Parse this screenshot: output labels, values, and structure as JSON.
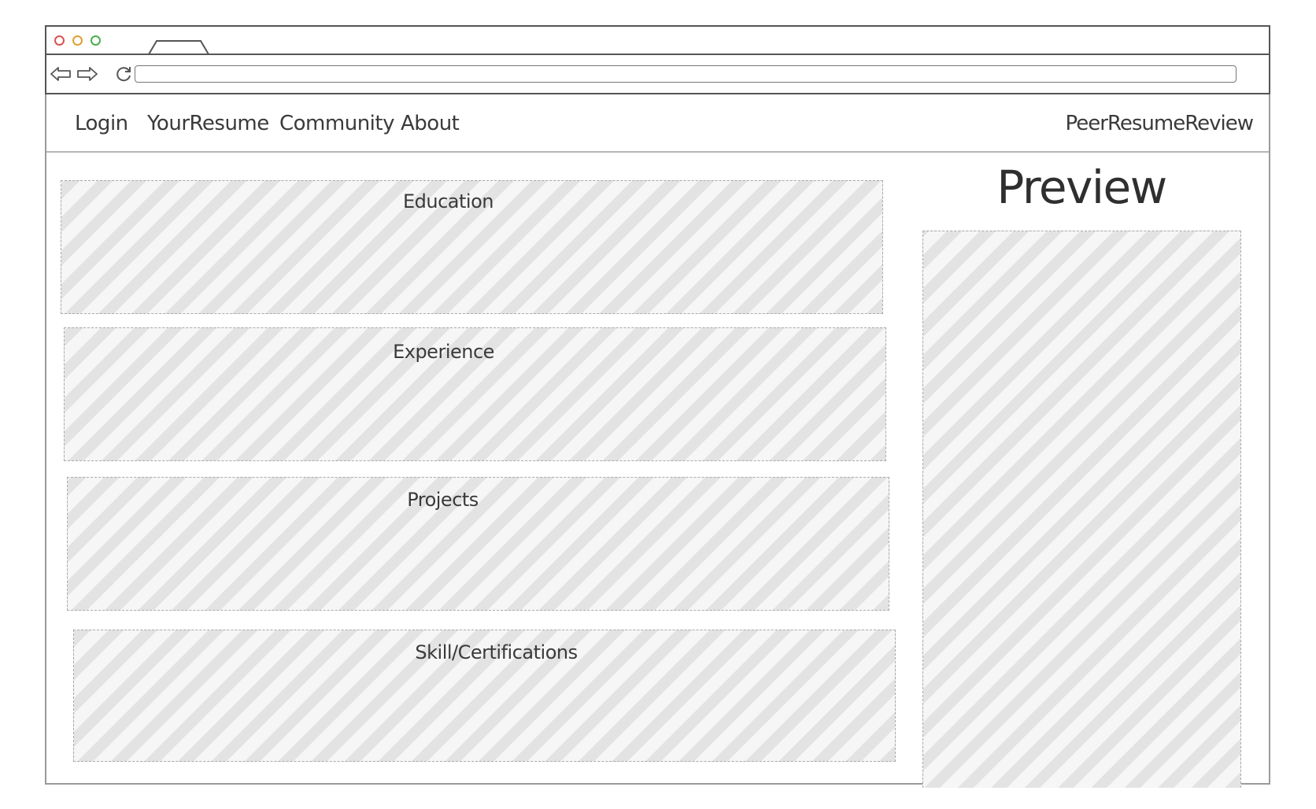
{
  "browser": {
    "traffic_lights": {
      "close_color": "#d9534f",
      "minimize_color": "#e0a030",
      "maximize_color": "#4cae4c"
    },
    "address": {
      "url": ""
    }
  },
  "nav": {
    "links": {
      "login": "Login",
      "your_resume": "YourResume",
      "community": "Community",
      "about": "About"
    },
    "brand": "PeerResumeReview"
  },
  "sections": {
    "education": "Education",
    "experience": "Experience",
    "projects": "Projects",
    "skills": "Skill/Certifications"
  },
  "preview": {
    "title": "Preview"
  }
}
